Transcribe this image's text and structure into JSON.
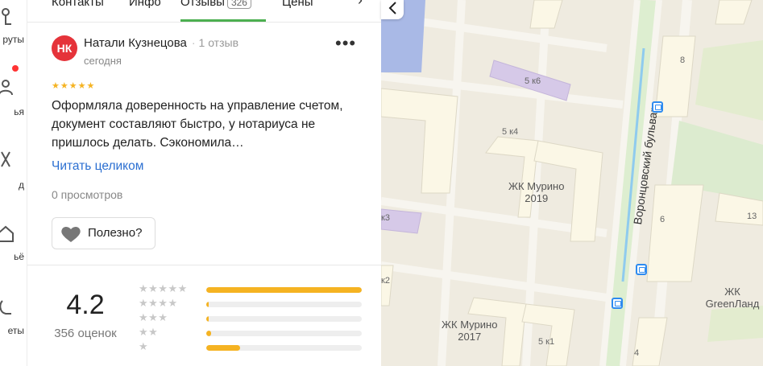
{
  "rail": {
    "items": [
      {
        "label": "руты",
        "icon": "route-icon"
      },
      {
        "label": "ья",
        "icon": "people-icon"
      },
      {
        "label": "д",
        "icon": "transport-icon"
      },
      {
        "label": "ьё",
        "icon": "housing-icon"
      },
      {
        "label": "еты",
        "icon": "accessibility-icon"
      }
    ]
  },
  "tabs": {
    "items": [
      {
        "label": "Контакты"
      },
      {
        "label": "Инфо"
      },
      {
        "label": "Отзывы",
        "count": "326"
      },
      {
        "label": "Цены"
      }
    ],
    "active_color": "#4caf50"
  },
  "review": {
    "avatar_initials": "НК",
    "avatar_color": "#e5333a",
    "author": "Натали Кузнецова",
    "author_reviews": "1 отзыв",
    "date": "сегодня",
    "stars": 5,
    "text": "Оформляла доверенность на управление счетом, документ составляют быстро, у нотариуса не пришлось делать. Сэкономила…",
    "read_more": "Читать целиком",
    "views": "0 просмотров",
    "useful_label": "Полезно?"
  },
  "rating": {
    "value": "4.2",
    "count": "356 оценок",
    "distribution": [
      {
        "stars": 5,
        "fraction": 1.0
      },
      {
        "stars": 4,
        "fraction": 0.01
      },
      {
        "stars": 3,
        "fraction": 0.01
      },
      {
        "stars": 2,
        "fraction": 0.03
      },
      {
        "stars": 1,
        "fraction": 0.22
      }
    ],
    "bar_color": "#f5b322"
  },
  "map": {
    "labels": {
      "b5k6": "5 к6",
      "b5k4": "5 к4",
      "murino2019": "ЖК Мурино\n2019",
      "murino2017": "ЖК Мурино\n2017",
      "b5k1": "5 к1",
      "k2": "к2",
      "k3": "к3",
      "b8": "8",
      "b6": "6",
      "b4": "4",
      "b13": "13",
      "greenland": "ЖК\nGreenЛанд",
      "street": "Воронцовский бульвар"
    }
  }
}
